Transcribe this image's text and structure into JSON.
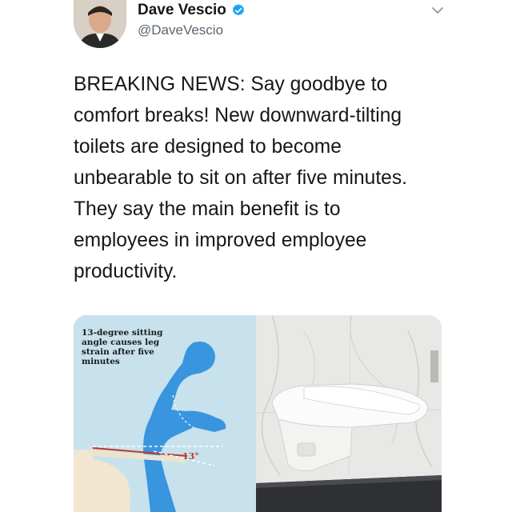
{
  "author": {
    "display_name": "Dave Vescio",
    "handle": "@DaveVescio",
    "verified": true,
    "avatar_icon": "profile-photo"
  },
  "menu": {
    "icon": "chevron-down-icon"
  },
  "tweet": {
    "text": "BREAKING NEWS: Say goodbye to\ncomfort breaks! New downward-tilting\ntoilets are designed to become\nunbearable to sit on after five minutes.\nThey say the main benefit is to\nemployees in improved employee\nproductivity."
  },
  "media": {
    "infographic_caption": "13-degree sitting angle causes leg strain after five minutes",
    "angle_label": "13°"
  },
  "colors": {
    "verified_blue": "#1da1f2",
    "infographic_bg": "#c7e2ec",
    "figure_blue": "#3a95df",
    "angle_red": "#c0392b"
  }
}
